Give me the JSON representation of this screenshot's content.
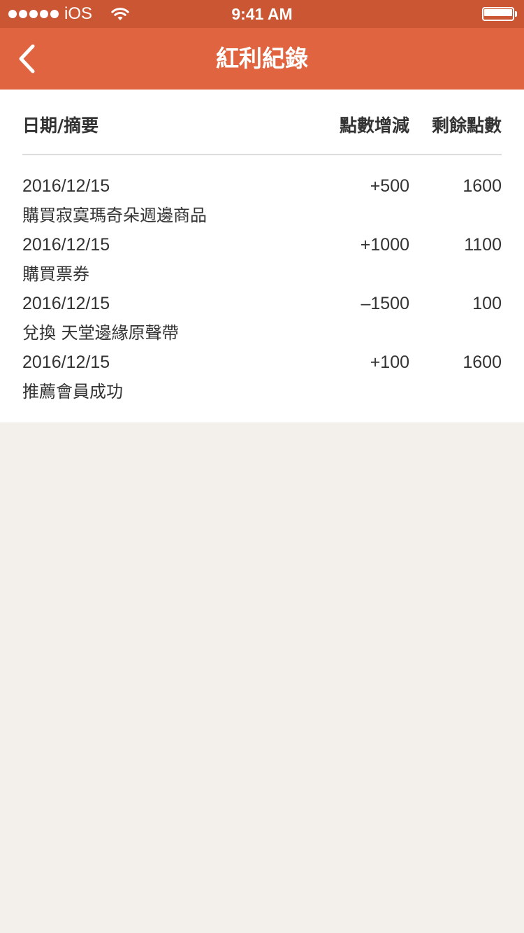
{
  "status_bar": {
    "carrier": "iOS",
    "time": "9:41 AM",
    "battery_level": 1.0,
    "signal_bars": 5,
    "wifi_icon": "wifi-icon",
    "battery_icon": "battery-icon"
  },
  "nav": {
    "title": "紅利紀錄",
    "back_icon": "chevron-left-icon",
    "color": "#e0643f"
  },
  "table": {
    "headers": {
      "date_summary": "日期/摘要",
      "change": "點數增減",
      "balance": "剩餘點數"
    },
    "rows": [
      {
        "date": "2016/12/15",
        "description": "購買寂寞瑪奇朵週邊商品",
        "change": "+500",
        "balance": "1600"
      },
      {
        "date": "2016/12/15",
        "description": "購買票券",
        "change": "+1000",
        "balance": "1100"
      },
      {
        "date": "2016/12/15",
        "description": "兌換 天堂邊緣原聲帶",
        "change": "–1500",
        "balance": "100"
      },
      {
        "date": "2016/12/15",
        "description": "推薦會員成功",
        "change": "+100",
        "balance": "1600"
      }
    ]
  },
  "colors": {
    "status_bar": "#cb5633",
    "nav_bar": "#e0643f",
    "page_background": "#f3f0eb",
    "content_background": "#ffffff",
    "text": "#333333"
  }
}
